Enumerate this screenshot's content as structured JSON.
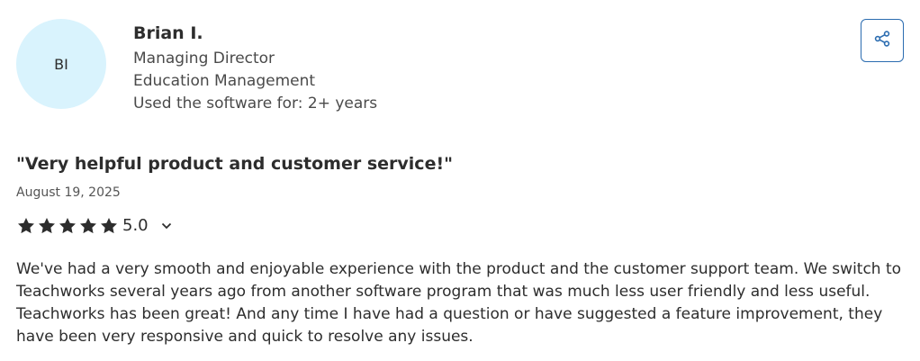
{
  "reviewer": {
    "initials": "BI",
    "name": "Brian I.",
    "role": "Managing Director",
    "industry": "Education Management",
    "usage": "Used the software for: 2+ years"
  },
  "review": {
    "title": "\"Very helpful product and customer service!\"",
    "date": "August 19, 2025",
    "rating_value": "5.0",
    "stars_filled": 5,
    "stars_total": 5,
    "body": "We've had a very smooth and enjoyable experience with the product and the customer support team. We switch to Teachworks several years ago from another software program that was much less user friendly and less useful. Teachworks has been great! And any time I have had a question or have suggested a feature improvement, they have been very responsive and quick to resolve any issues."
  },
  "icons": {
    "share": "share-icon",
    "star": "star-icon",
    "chevron": "chevron-down-icon"
  },
  "colors": {
    "avatar_bg": "#d9f3fd",
    "share_accent": "#2b6cb0",
    "text_primary": "#2d2d2d",
    "text_secondary": "#4a4a4a"
  }
}
